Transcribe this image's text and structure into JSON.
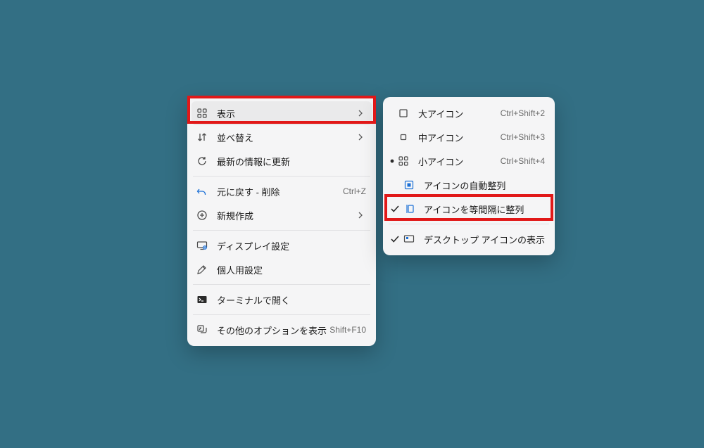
{
  "main": {
    "view": "表示",
    "sort": "並べ替え",
    "refresh": "最新の情報に更新",
    "undo": "元に戻す - 削除",
    "undoShortcut": "Ctrl+Z",
    "new": "新規作成",
    "display": "ディスプレイ設定",
    "personalize": "個人用設定",
    "terminal": "ターミナルで開く",
    "more": "その他のオプションを表示",
    "moreShortcut": "Shift+F10"
  },
  "sub": {
    "large": "大アイコン",
    "largeShortcut": "Ctrl+Shift+2",
    "medium": "中アイコン",
    "mediumShortcut": "Ctrl+Shift+3",
    "small": "小アイコン",
    "smallShortcut": "Ctrl+Shift+4",
    "autoArrange": "アイコンの自動整列",
    "alignGrid": "アイコンを等間隔に整列",
    "showIcons": "デスクトップ アイコンの表示"
  }
}
